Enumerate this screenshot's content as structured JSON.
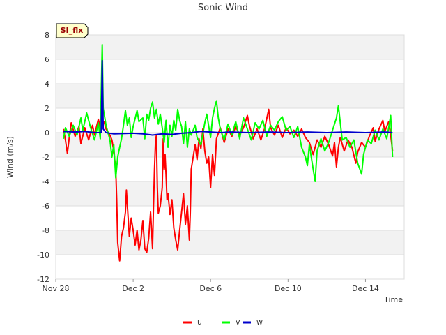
{
  "chart_data": {
    "type": "line",
    "title": "Sonic Wind",
    "badge": "SI_flx",
    "xlabel": "Time",
    "ylabel": "Wind (m/s)",
    "ylim": [
      -12,
      8
    ],
    "yticks": [
      -12,
      -10,
      -8,
      -6,
      -4,
      -2,
      0,
      2,
      4,
      6,
      8
    ],
    "xlim": [
      0,
      18
    ],
    "xticks": [
      {
        "day": 0,
        "label": "Nov 28"
      },
      {
        "day": 4,
        "label": "Dec 2"
      },
      {
        "day": 8,
        "label": "Dec 6"
      },
      {
        "day": 12,
        "label": "Dec 10"
      },
      {
        "day": 16,
        "label": "Dec 14"
      }
    ],
    "grid": true,
    "legend_position": "bottom-center",
    "series": [
      {
        "name": "u",
        "color": "#ff0000",
        "points": [
          [
            0.4,
            0.3
          ],
          [
            0.5,
            -0.6
          ],
          [
            0.6,
            -1.7
          ],
          [
            0.7,
            -0.4
          ],
          [
            0.8,
            0.8
          ],
          [
            1.0,
            -0.3
          ],
          [
            1.2,
            0.5
          ],
          [
            1.3,
            -0.9
          ],
          [
            1.5,
            0.4
          ],
          [
            1.7,
            -0.6
          ],
          [
            1.9,
            0.6
          ],
          [
            2.0,
            -0.2
          ],
          [
            2.2,
            1.1
          ],
          [
            2.3,
            0.4
          ],
          [
            2.5,
            0.9
          ],
          [
            2.6,
            0.3
          ],
          [
            2.8,
            -0.2
          ],
          [
            2.9,
            -0.6
          ],
          [
            3.0,
            -1.5
          ],
          [
            3.1,
            -3.0
          ],
          [
            3.15,
            -5.5
          ],
          [
            3.2,
            -9.0
          ],
          [
            3.3,
            -10.5
          ],
          [
            3.4,
            -8.5
          ],
          [
            3.5,
            -7.8
          ],
          [
            3.6,
            -6.5
          ],
          [
            3.65,
            -4.7
          ],
          [
            3.7,
            -6.0
          ],
          [
            3.8,
            -8.5
          ],
          [
            3.9,
            -7.0
          ],
          [
            4.0,
            -8.0
          ],
          [
            4.1,
            -9.2
          ],
          [
            4.2,
            -8.0
          ],
          [
            4.3,
            -9.6
          ],
          [
            4.4,
            -8.8
          ],
          [
            4.5,
            -7.2
          ],
          [
            4.6,
            -9.5
          ],
          [
            4.7,
            -9.8
          ],
          [
            4.8,
            -8.7
          ],
          [
            4.9,
            -6.5
          ],
          [
            5.0,
            -9.5
          ],
          [
            5.05,
            -6.0
          ],
          [
            5.1,
            -3.0
          ],
          [
            5.15,
            -0.8
          ],
          [
            5.2,
            -0.2
          ],
          [
            5.25,
            -4.5
          ],
          [
            5.3,
            -6.6
          ],
          [
            5.4,
            -6.0
          ],
          [
            5.5,
            -4.5
          ],
          [
            5.55,
            -0.5
          ],
          [
            5.6,
            -3.0
          ],
          [
            5.65,
            -1.8
          ],
          [
            5.7,
            -3.5
          ],
          [
            5.75,
            -5.5
          ],
          [
            5.8,
            -5.0
          ],
          [
            5.9,
            -6.7
          ],
          [
            6.0,
            -5.5
          ],
          [
            6.1,
            -7.8
          ],
          [
            6.2,
            -8.8
          ],
          [
            6.3,
            -9.6
          ],
          [
            6.4,
            -8.0
          ],
          [
            6.5,
            -6.5
          ],
          [
            6.6,
            -5.0
          ],
          [
            6.7,
            -7.5
          ],
          [
            6.8,
            -6.0
          ],
          [
            6.9,
            -8.8
          ],
          [
            6.95,
            -6.5
          ],
          [
            7.0,
            -3.0
          ],
          [
            7.1,
            -2.0
          ],
          [
            7.2,
            -1.0
          ],
          [
            7.3,
            -2.2
          ],
          [
            7.4,
            -0.5
          ],
          [
            7.5,
            -1.3
          ],
          [
            7.6,
            0.3
          ],
          [
            7.7,
            -1.5
          ],
          [
            7.8,
            -2.5
          ],
          [
            7.9,
            -2.0
          ],
          [
            8.0,
            -4.5
          ],
          [
            8.1,
            -1.8
          ],
          [
            8.2,
            -3.5
          ],
          [
            8.3,
            -0.5
          ],
          [
            8.5,
            0.4
          ],
          [
            8.7,
            -0.8
          ],
          [
            8.9,
            0.3
          ],
          [
            9.1,
            -0.3
          ],
          [
            9.3,
            0.5
          ],
          [
            9.5,
            -0.2
          ],
          [
            9.7,
            0.4
          ],
          [
            9.9,
            1.4
          ],
          [
            10.0,
            0.6
          ],
          [
            10.2,
            -0.5
          ],
          [
            10.4,
            0.3
          ],
          [
            10.6,
            -0.6
          ],
          [
            10.8,
            0.4
          ],
          [
            11.0,
            1.9
          ],
          [
            11.1,
            0.4
          ],
          [
            11.3,
            -0.2
          ],
          [
            11.5,
            0.6
          ],
          [
            11.7,
            -0.4
          ],
          [
            11.9,
            0.4
          ],
          [
            12.1,
            -0.1
          ],
          [
            12.3,
            0.2
          ],
          [
            12.5,
            -0.3
          ],
          [
            12.7,
            0.3
          ],
          [
            12.9,
            -0.4
          ],
          [
            13.1,
            -0.8
          ],
          [
            13.3,
            -1.8
          ],
          [
            13.5,
            -0.6
          ],
          [
            13.7,
            -1.2
          ],
          [
            13.9,
            -0.3
          ],
          [
            14.1,
            -1.0
          ],
          [
            14.3,
            -1.9
          ],
          [
            14.4,
            -0.8
          ],
          [
            14.5,
            -2.8
          ],
          [
            14.6,
            -1.2
          ],
          [
            14.7,
            -0.4
          ],
          [
            14.9,
            -1.5
          ],
          [
            15.1,
            -0.6
          ],
          [
            15.3,
            -1.2
          ],
          [
            15.5,
            -2.5
          ],
          [
            15.6,
            -1.6
          ],
          [
            15.8,
            -0.8
          ],
          [
            16.0,
            -1.2
          ],
          [
            16.2,
            -0.3
          ],
          [
            16.4,
            0.4
          ],
          [
            16.5,
            -0.7
          ],
          [
            16.7,
            0.3
          ],
          [
            16.9,
            1.0
          ],
          [
            17.0,
            0.1
          ],
          [
            17.2,
            0.9
          ],
          [
            17.3,
            -0.2
          ],
          [
            17.4,
            -1.5
          ]
        ]
      },
      {
        "name": "v",
        "color": "#00ff00",
        "points": [
          [
            0.4,
            -0.5
          ],
          [
            0.5,
            0.4
          ],
          [
            0.7,
            -0.3
          ],
          [
            0.9,
            0.6
          ],
          [
            1.1,
            -0.2
          ],
          [
            1.3,
            1.2
          ],
          [
            1.4,
            0.2
          ],
          [
            1.6,
            1.6
          ],
          [
            1.8,
            0.4
          ],
          [
            2.0,
            -0.6
          ],
          [
            2.2,
            0.8
          ],
          [
            2.3,
            -0.5
          ],
          [
            2.4,
            7.2
          ],
          [
            2.45,
            2.0
          ],
          [
            2.6,
            0.6
          ],
          [
            2.8,
            -0.6
          ],
          [
            2.9,
            -2.0
          ],
          [
            3.0,
            -1.0
          ],
          [
            3.1,
            -3.7
          ],
          [
            3.2,
            -2.0
          ],
          [
            3.3,
            -1.2
          ],
          [
            3.4,
            -0.5
          ],
          [
            3.5,
            0.6
          ],
          [
            3.6,
            1.8
          ],
          [
            3.7,
            0.6
          ],
          [
            3.8,
            1.2
          ],
          [
            3.9,
            -0.4
          ],
          [
            4.0,
            0.5
          ],
          [
            4.2,
            1.8
          ],
          [
            4.3,
            0.9
          ],
          [
            4.5,
            1.2
          ],
          [
            4.6,
            -0.5
          ],
          [
            4.7,
            1.5
          ],
          [
            4.8,
            1.0
          ],
          [
            4.9,
            2.0
          ],
          [
            5.0,
            2.5
          ],
          [
            5.1,
            1.2
          ],
          [
            5.2,
            1.9
          ],
          [
            5.3,
            0.7
          ],
          [
            5.4,
            1.5
          ],
          [
            5.5,
            0.4
          ],
          [
            5.6,
            -0.8
          ],
          [
            5.7,
            1.0
          ],
          [
            5.8,
            -1.2
          ],
          [
            5.9,
            0.6
          ],
          [
            6.0,
            -0.3
          ],
          [
            6.1,
            1.0
          ],
          [
            6.2,
            0.2
          ],
          [
            6.3,
            1.9
          ],
          [
            6.4,
            1.0
          ],
          [
            6.5,
            0.5
          ],
          [
            6.6,
            -0.9
          ],
          [
            6.7,
            0.9
          ],
          [
            6.8,
            -1.2
          ],
          [
            6.9,
            0.3
          ],
          [
            7.0,
            -0.2
          ],
          [
            7.2,
            0.6
          ],
          [
            7.3,
            -0.4
          ],
          [
            7.5,
            -1.0
          ],
          [
            7.7,
            0.8
          ],
          [
            7.8,
            1.5
          ],
          [
            8.0,
            -0.4
          ],
          [
            8.1,
            1.2
          ],
          [
            8.2,
            2.0
          ],
          [
            8.3,
            2.6
          ],
          [
            8.4,
            1.2
          ],
          [
            8.5,
            0.3
          ],
          [
            8.7,
            -0.6
          ],
          [
            8.9,
            0.7
          ],
          [
            9.1,
            -0.2
          ],
          [
            9.3,
            0.9
          ],
          [
            9.5,
            -0.5
          ],
          [
            9.7,
            1.2
          ],
          [
            9.9,
            0.3
          ],
          [
            10.1,
            -0.6
          ],
          [
            10.3,
            0.8
          ],
          [
            10.5,
            0.3
          ],
          [
            10.7,
            1.0
          ],
          [
            10.9,
            -0.3
          ],
          [
            11.1,
            0.6
          ],
          [
            11.3,
            0.2
          ],
          [
            11.5,
            0.9
          ],
          [
            11.7,
            1.3
          ],
          [
            11.9,
            0.2
          ],
          [
            12.1,
            0.5
          ],
          [
            12.3,
            -0.4
          ],
          [
            12.5,
            0.5
          ],
          [
            12.7,
            -1.2
          ],
          [
            12.9,
            -2.0
          ],
          [
            13.0,
            -2.7
          ],
          [
            13.1,
            -1.0
          ],
          [
            13.3,
            -3.0
          ],
          [
            13.4,
            -4.0
          ],
          [
            13.5,
            -1.5
          ],
          [
            13.7,
            -0.5
          ],
          [
            13.9,
            -1.5
          ],
          [
            14.1,
            -0.8
          ],
          [
            14.3,
            0.2
          ],
          [
            14.5,
            1.2
          ],
          [
            14.6,
            2.2
          ],
          [
            14.8,
            -0.6
          ],
          [
            15.0,
            -0.4
          ],
          [
            15.2,
            -1.2
          ],
          [
            15.4,
            -0.6
          ],
          [
            15.6,
            -2.5
          ],
          [
            15.8,
            -3.4
          ],
          [
            15.9,
            -1.8
          ],
          [
            16.1,
            -0.6
          ],
          [
            16.3,
            -0.9
          ],
          [
            16.5,
            0.2
          ],
          [
            16.7,
            -0.6
          ],
          [
            16.9,
            0.3
          ],
          [
            17.1,
            -0.5
          ],
          [
            17.3,
            1.4
          ],
          [
            17.4,
            -2.0
          ]
        ]
      },
      {
        "name": "w",
        "color": "#0000cc",
        "points": [
          [
            0.4,
            0.1
          ],
          [
            1.0,
            0.05
          ],
          [
            1.5,
            0.1
          ],
          [
            2.0,
            0.0
          ],
          [
            2.35,
            0.0
          ],
          [
            2.4,
            5.9
          ],
          [
            2.45,
            0.3
          ],
          [
            2.6,
            0.0
          ],
          [
            3.0,
            -0.1
          ],
          [
            4.0,
            -0.05
          ],
          [
            4.5,
            -0.1
          ],
          [
            5.0,
            -0.2
          ],
          [
            5.5,
            -0.1
          ],
          [
            6.0,
            -0.15
          ],
          [
            6.5,
            -0.05
          ],
          [
            7.0,
            0.0
          ],
          [
            7.5,
            0.1
          ],
          [
            8.0,
            0.05
          ],
          [
            8.5,
            0.0
          ],
          [
            9.0,
            0.05
          ],
          [
            10.0,
            0.0
          ],
          [
            11.0,
            0.05
          ],
          [
            12.0,
            0.0
          ],
          [
            13.0,
            0.05
          ],
          [
            14.0,
            0.0
          ],
          [
            15.0,
            0.05
          ],
          [
            16.0,
            0.0
          ],
          [
            17.0,
            0.05
          ],
          [
            17.4,
            0.0
          ]
        ]
      }
    ]
  }
}
